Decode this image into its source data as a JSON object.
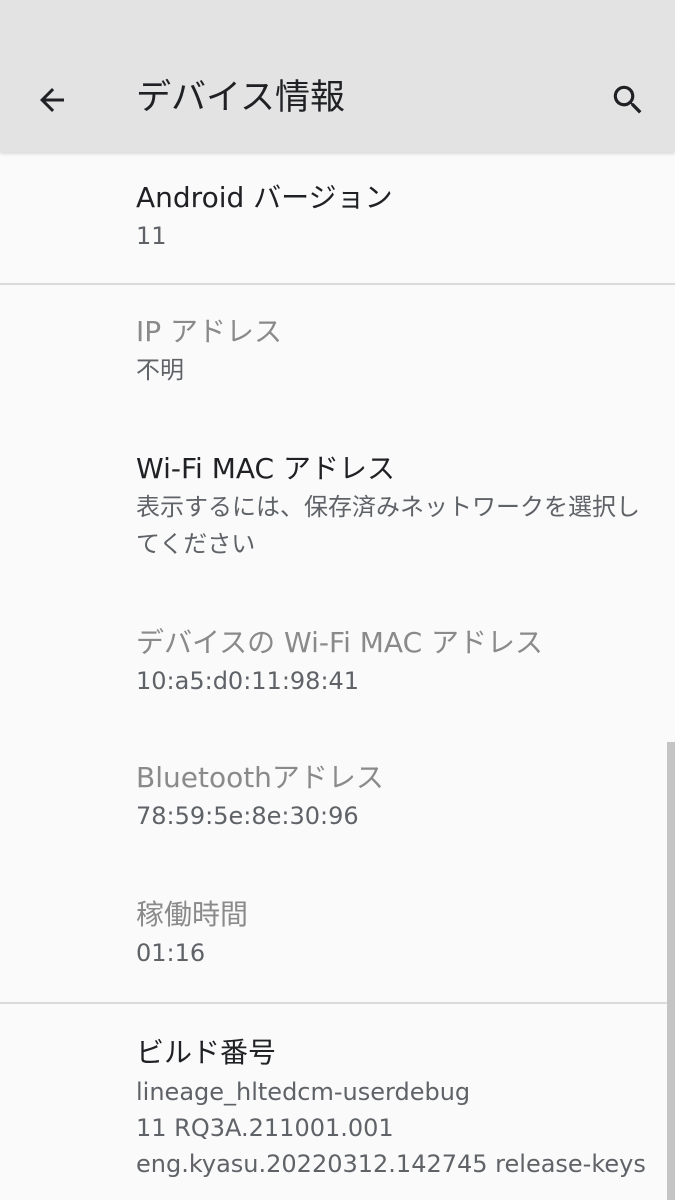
{
  "app_bar": {
    "title": "デバイス情報",
    "back_icon": "arrow-left-icon",
    "search_icon": "search-icon"
  },
  "items": [
    {
      "title": "Android バージョン",
      "summary": "11"
    },
    {
      "title": "IP アドレス",
      "summary": "不明"
    },
    {
      "title": "Wi-Fi MAC アドレス",
      "summary": "表示するには、保存済みネットワークを選択してください"
    },
    {
      "title": "デバイスの Wi-Fi MAC アドレス",
      "summary": "10:a5:d0:11:98:41"
    },
    {
      "title": "Bluetoothアドレス",
      "summary": "78:59:5e:8e:30:96"
    },
    {
      "title": "稼働時間",
      "summary": "01:16"
    },
    {
      "title": "ビルド番号",
      "summary": "lineage_hltedcm-userdebug\n11 RQ3A.211001.001\neng.kyasu.20220312.142745 release-keys"
    }
  ],
  "colors": {
    "app_bar_bg": "#e3e3e3",
    "background": "#fafafa",
    "primary_text": "#202124",
    "secondary_text": "#5f6368"
  }
}
